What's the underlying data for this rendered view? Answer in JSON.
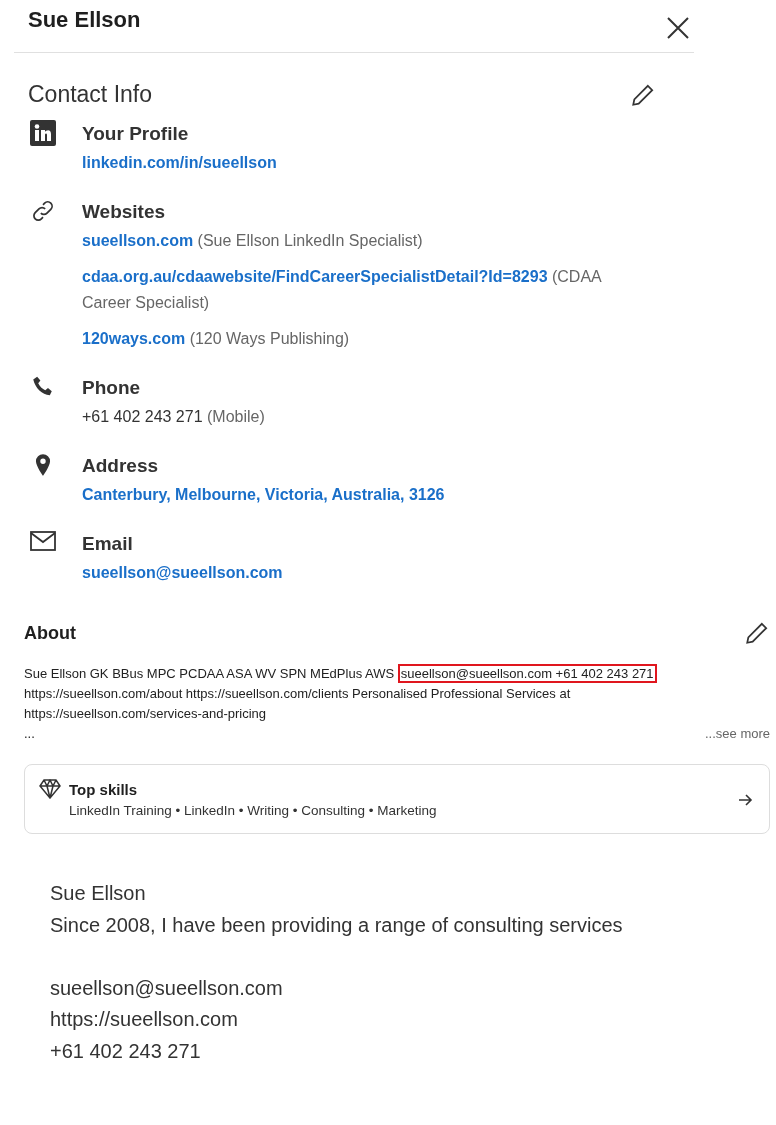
{
  "header": {
    "title": "Sue Ellson"
  },
  "contact": {
    "title": "Contact Info",
    "sections": [
      {
        "kind": "profile",
        "label": "Your Profile",
        "entries": [
          {
            "link": "linkedin.com/in/sueellson"
          }
        ]
      },
      {
        "kind": "websites",
        "label": "Websites",
        "entries": [
          {
            "link": "sueellson.com",
            "note": "(Sue Ellson LinkedIn Specialist)"
          },
          {
            "link": "cdaa.org.au/cdaawebsite/FindCareerSpecialistDetail?Id=8293",
            "note": "(CDAA Career Specialist)"
          },
          {
            "link": "120ways.com",
            "note": "(120 Ways Publishing)"
          }
        ]
      },
      {
        "kind": "phone",
        "label": "Phone",
        "entries": [
          {
            "text": "+61 402 243 271",
            "note": "(Mobile)"
          }
        ]
      },
      {
        "kind": "address",
        "label": "Address",
        "entries": [
          {
            "link": "Canterbury, Melbourne, Victoria, Australia, 3126"
          }
        ]
      },
      {
        "kind": "email",
        "label": "Email",
        "entries": [
          {
            "link": "sueellson@sueellson.com"
          }
        ]
      }
    ]
  },
  "about": {
    "title": "About",
    "text_before": "Sue Ellson GK BBus MPC PCDAA ASA WV SPN MEdPlus AWS",
    "highlighted": "sueellson@sueellson.com +61 402 243 271",
    "text_after": "https://sueellson.com/about https://sueellson.com/clients Personalised Professional Services at https://sueellson.com/services-and-pricing",
    "ellipsis": "...",
    "see_more": "...see more"
  },
  "top_skills": {
    "title": "Top skills",
    "skills": "LinkedIn Training • LinkedIn • Writing • Consulting • Marketing"
  },
  "excerpt": {
    "paragraphs": [
      [
        "Sue Ellson",
        "Since 2008, I have been providing a range of consulting services"
      ],
      [
        "sueellson@sueellson.com",
        "https://sueellson.com",
        "+61 402 243 271"
      ]
    ]
  }
}
